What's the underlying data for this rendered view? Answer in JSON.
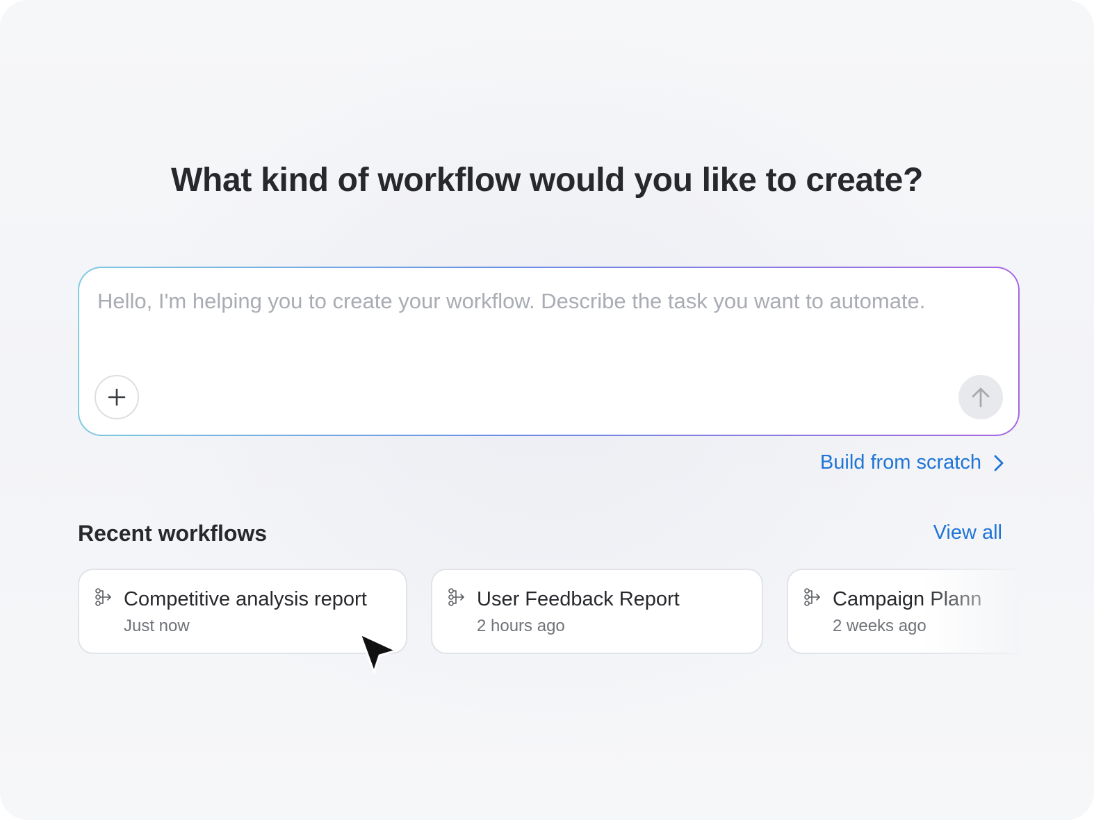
{
  "heading": "What kind of workflow would you like to create?",
  "prompt": {
    "placeholder": "Hello, I'm helping you to create your workflow. Describe the task you want to automate.",
    "value": "",
    "add_icon": "plus-icon",
    "send_icon": "arrow-up-icon"
  },
  "build_from_scratch": {
    "label": "Build from scratch",
    "icon": "chevron-right-icon"
  },
  "recent": {
    "title": "Recent workflows",
    "view_all": "View all",
    "items": [
      {
        "title": "Competitive analysis report",
        "time": "Just now",
        "icon": "workflow-icon"
      },
      {
        "title": "User Feedback Report",
        "time": "2 hours ago",
        "icon": "workflow-icon"
      },
      {
        "title": "Campaign Plann",
        "time": "2 weeks ago",
        "icon": "workflow-icon"
      }
    ]
  },
  "colors": {
    "accent": "#1f74d6",
    "heading": "#26282c",
    "gradient_start": "#7fcbe0",
    "gradient_end": "#a766e0"
  }
}
